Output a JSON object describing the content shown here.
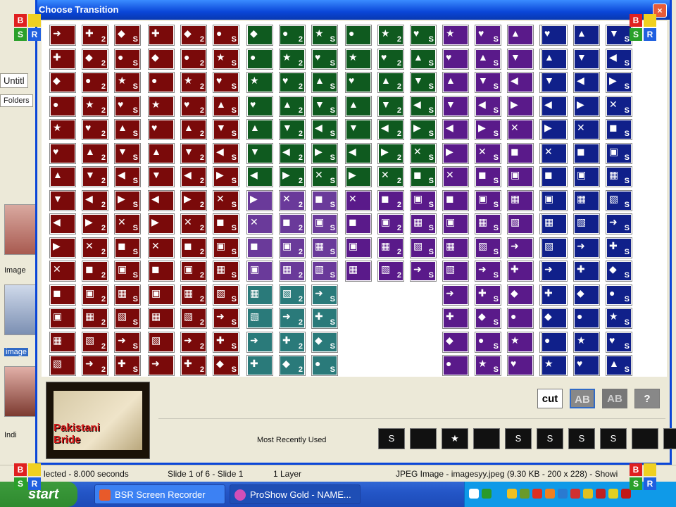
{
  "back_app": {
    "tab1": "Untitl",
    "tab2": "Folders",
    "label_image": "Image",
    "label_image2": "image",
    "label_ind": "Indi"
  },
  "dialog": {
    "title": "Choose Transition",
    "close": "×"
  },
  "grid": {
    "rows": 15,
    "columns": [
      {
        "group": "A",
        "color": "#7a0a0a",
        "marks": [
          "",
          "2",
          "S"
        ]
      },
      {
        "group": "B",
        "color": "#7a0a0a",
        "marks": [
          "",
          "2",
          "S"
        ]
      },
      {
        "group": "C",
        "color": "#0f5a1f",
        "marks": [
          "",
          "2",
          "S"
        ]
      },
      {
        "group": "D",
        "color": "#0f5a1f",
        "marks": [
          "",
          "2",
          "S"
        ]
      },
      {
        "group": "E",
        "color": "#5a1a8a",
        "marks": [
          "",
          "S",
          "",
          "S"
        ]
      },
      {
        "group": "F",
        "color": "#10208a",
        "marks": [
          "",
          "",
          "S"
        ]
      }
    ]
  },
  "bottom": {
    "preview_text_line1": "Pakistani",
    "preview_text_line2": "Bride",
    "btn_cut": "cut",
    "btn_ab": "AB",
    "btn_ab2": "AB",
    "btn_help": "?",
    "mru_label": "Most Recently Used",
    "mru_items": [
      "S",
      "",
      "★",
      "",
      "S",
      "S",
      "S",
      "S",
      "",
      ""
    ]
  },
  "status": {
    "selected": "lected - 8.000 seconds",
    "slide": "Slide 1 of 6 - Slide 1",
    "layer": "1 Layer",
    "file": "JPEG Image - imagesyy.jpeg (9.30 KB - 200 x 228) - Showi"
  },
  "taskbar": {
    "start": "start",
    "task1": "BSR Screen Recorder",
    "task2": "ProShow Gold - NAME..."
  },
  "bsr_badge": {
    "b": "B",
    "s": "S",
    "r": "R"
  },
  "colors": {
    "titlebar": "#0a46d8",
    "dark_red": "#7a0a0a",
    "green": "#0f5a1f",
    "purple": "#5a1a8a",
    "navy": "#10208a"
  }
}
